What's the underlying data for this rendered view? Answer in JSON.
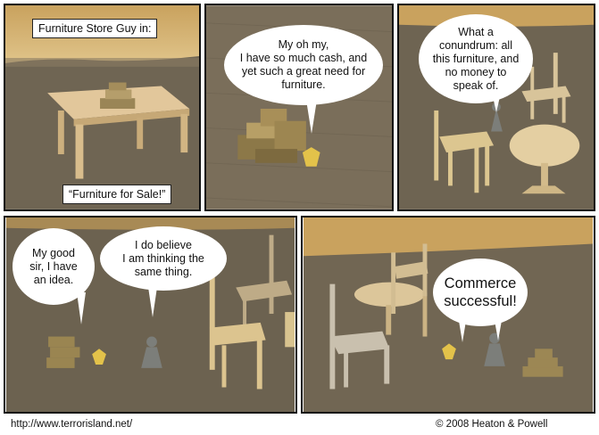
{
  "panel1": {
    "caption_top": "Furniture Store Guy in:",
    "caption_bottom": "“Furniture for Sale!”"
  },
  "panel2": {
    "bubble": "My oh my,\nI have so much cash, and\nyet such a great need for\nfurniture."
  },
  "panel3": {
    "bubble": "What a\nconundrum: all\nthis furniture, and\nno money to\nspeak of."
  },
  "panel4": {
    "bubble_left": "My good\nsir, I have\nan idea.",
    "bubble_right": "I do believe\nI am thinking the\nsame thing."
  },
  "panel5": {
    "bubble": "Commerce\nsuccessful!"
  },
  "footer": {
    "url": "http://www.terrorisland.net/",
    "copyright": "© 2008 Heaton & Powell"
  }
}
